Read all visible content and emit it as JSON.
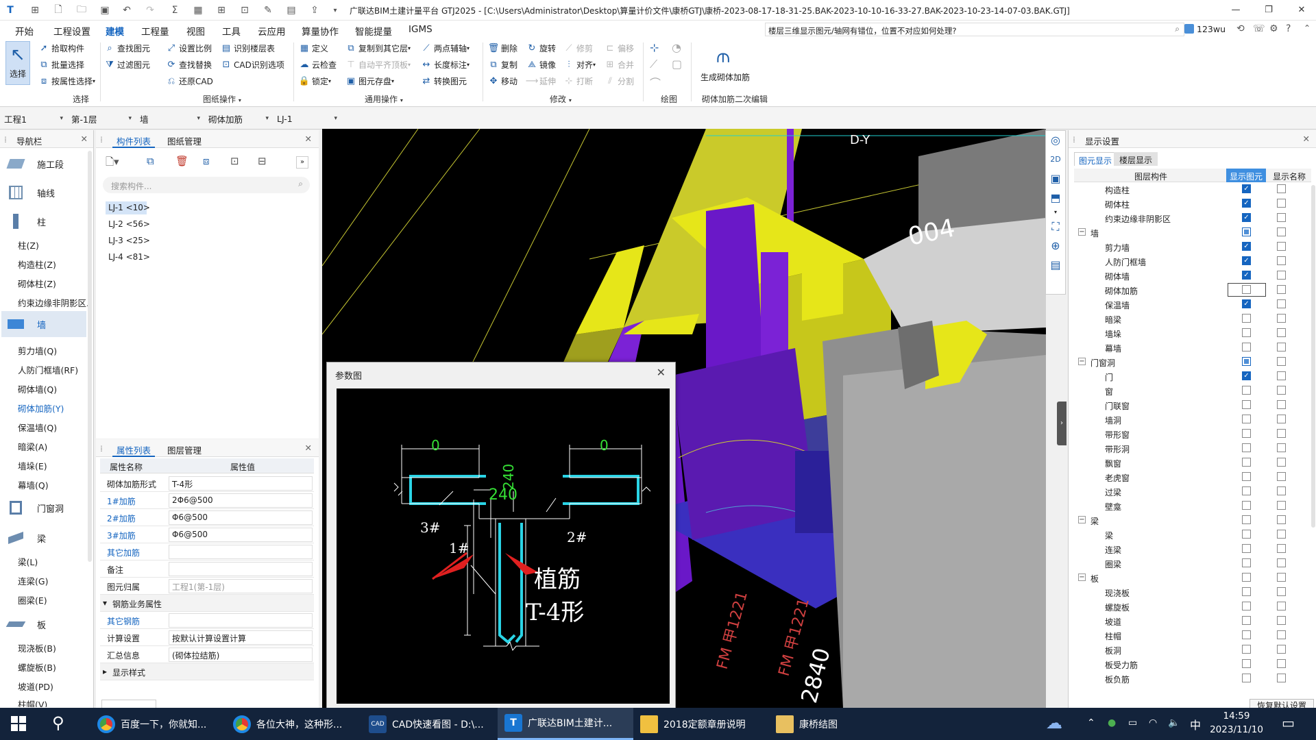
{
  "app": {
    "title": "广联达BIM土建计量平台 GTJ2025 - [C:\\Users\\Administrator\\Desktop\\算量计价文件\\康桥GTJ\\康桥-2023-08-17-18-31-25.BAK-2023-10-10-16-33-27.BAK-2023-10-23-14-07-03.BAK.GTJ]",
    "user": "123wu",
    "help_question": "楼层三维显示图元/轴网有错位，位置不对应如何处理?"
  },
  "menu": [
    "开始",
    "工程设置",
    "建模",
    "工程量",
    "视图",
    "工具",
    "云应用",
    "算量协作",
    "智能提量",
    "IGMS"
  ],
  "menu_active": "建模",
  "ribbon": {
    "select": "选择",
    "select_items": [
      "拾取构件",
      "批量选择",
      "按属性选择"
    ],
    "select_group": "选择",
    "drawing_items": [
      "查找图元",
      "过滤图元",
      "设置比例",
      "查找替换",
      "还原CAD",
      "识别楼层表",
      "CAD识别选项"
    ],
    "drawing_group": "图纸操作",
    "common_items": [
      "定义",
      "云检查",
      "锁定",
      "复制到其它层",
      "自动平齐顶板",
      "图元存盘",
      "两点辅轴",
      "长度标注",
      "转换图元"
    ],
    "common_group": "通用操作",
    "modify_items": [
      "删除",
      "旋转",
      "修剪",
      "偏移",
      "复制",
      "镜像",
      "对齐",
      "合并",
      "移动",
      "延伸",
      "打断",
      "分割"
    ],
    "modify_group": "修改",
    "draw_group": "绘图",
    "gen_label": "生成砌体加筋",
    "gen_group": "砌体加筋二次编辑"
  },
  "selectors": [
    "工程1",
    "第-1层",
    "墙",
    "砌体加筋",
    "LJ-1"
  ],
  "nav": {
    "title": "导航栏",
    "big": [
      {
        "label": "施工段",
        "icon": "construction-section-icon"
      },
      {
        "label": "轴线",
        "icon": "axis-icon"
      },
      {
        "label": "柱",
        "icon": "column-icon"
      },
      {
        "label": "墙",
        "icon": "wall-icon"
      },
      {
        "label": "门窗洞",
        "icon": "door-window-icon"
      },
      {
        "label": "梁",
        "icon": "beam-icon"
      },
      {
        "label": "板",
        "icon": "slab-icon"
      }
    ],
    "column_items": [
      "柱(Z)",
      "构造柱(Z)",
      "砌体柱(Z)",
      "约束边缘非阴影区."
    ],
    "wall_items": [
      "剪力墙(Q)",
      "人防门框墙(RF)",
      "砌体墙(Q)",
      "砌体加筋(Y)",
      "保温墙(Q)",
      "暗梁(A)",
      "墙垛(E)",
      "幕墙(Q)"
    ],
    "wall_active": "砌体加筋(Y)",
    "beam_items": [
      "梁(L)",
      "连梁(G)",
      "圈梁(E)"
    ],
    "slab_items": [
      "现浇板(B)",
      "螺旋板(B)",
      "坡道(PD)",
      "柱帽(V)"
    ]
  },
  "components": {
    "tabs": [
      "构件列表",
      "图纸管理"
    ],
    "search_placeholder": "搜索构件...",
    "items": [
      "LJ-1 <10>",
      "LJ-2 <56>",
      "LJ-3 <25>",
      "LJ-4 <81>"
    ],
    "selected": "LJ-1 <10>"
  },
  "props": {
    "tabs": [
      "属性列表",
      "图层管理"
    ],
    "col_name": "属性名称",
    "col_value": "属性值",
    "rows": [
      {
        "k": "砌体加筋形式",
        "v": "T-4形"
      },
      {
        "k": "1#加筋",
        "v": "2Φ6@500"
      },
      {
        "k": "2#加筋",
        "v": "Φ6@500"
      },
      {
        "k": "3#加筋",
        "v": "Φ6@500"
      },
      {
        "k": "其它加筋",
        "v": ""
      },
      {
        "k": "备注",
        "v": ""
      },
      {
        "k": "图元归属",
        "v": "工程1(第-1层)"
      },
      {
        "k": "钢筋业务属性",
        "v": ""
      },
      {
        "k": "其它钢筋",
        "v": ""
      },
      {
        "k": "计算设置",
        "v": "按默认计算设置计算"
      },
      {
        "k": "汇总信息",
        "v": "(砌体拉结筋)"
      },
      {
        "k": "显示样式",
        "v": ""
      }
    ]
  },
  "dialog": {
    "title": "参数图",
    "dim_left": "0",
    "dim_right": "0",
    "dim_240a": "240",
    "dim_240b": "240",
    "label_3": "3#",
    "label_2": "2#",
    "label_1": "1#",
    "label_plant": "植筋",
    "label_type": "T-4形"
  },
  "viewport": {
    "label_dy": "D-Y",
    "label_004": "004",
    "label_fm1": "FM 甲1221",
    "label_fm2": "FM 甲1221",
    "label_2840": "2840"
  },
  "display": {
    "title": "显示设置",
    "tabs": [
      "图元显示",
      "楼层显示"
    ],
    "col_layer": "图层构件",
    "col_show": "显示图元",
    "col_name": "显示名称",
    "restore": "恢复默认设置",
    "rows": [
      {
        "label": "构造柱",
        "level": 1,
        "show": "on",
        "name": false
      },
      {
        "label": "砌体柱",
        "level": 1,
        "show": "on",
        "name": false
      },
      {
        "label": "约束边缘非阴影区",
        "level": 1,
        "show": "on",
        "name": false
      },
      {
        "label": "墙",
        "level": 0,
        "show": "part",
        "name": false
      },
      {
        "label": "剪力墙",
        "level": 1,
        "show": "on",
        "name": false
      },
      {
        "label": "人防门框墙",
        "level": 1,
        "show": "on",
        "name": false
      },
      {
        "label": "砌体墙",
        "level": 1,
        "show": "on",
        "name": false
      },
      {
        "label": "砌体加筋",
        "level": 1,
        "show": "off",
        "name": false,
        "focus": true
      },
      {
        "label": "保温墙",
        "level": 1,
        "show": "on",
        "name": false
      },
      {
        "label": "暗梁",
        "level": 1,
        "show": "off",
        "name": false
      },
      {
        "label": "墙垛",
        "level": 1,
        "show": "off",
        "name": false
      },
      {
        "label": "幕墙",
        "level": 1,
        "show": "off",
        "name": false
      },
      {
        "label": "门窗洞",
        "level": 0,
        "show": "part",
        "name": false
      },
      {
        "label": "门",
        "level": 1,
        "show": "on",
        "name": false
      },
      {
        "label": "窗",
        "level": 1,
        "show": "off",
        "name": false
      },
      {
        "label": "门联窗",
        "level": 1,
        "show": "off",
        "name": false
      },
      {
        "label": "墙洞",
        "level": 1,
        "show": "off",
        "name": false
      },
      {
        "label": "带形窗",
        "level": 1,
        "show": "off",
        "name": false
      },
      {
        "label": "带形洞",
        "level": 1,
        "show": "off",
        "name": false
      },
      {
        "label": "飘窗",
        "level": 1,
        "show": "off",
        "name": false
      },
      {
        "label": "老虎窗",
        "level": 1,
        "show": "off",
        "name": false
      },
      {
        "label": "过梁",
        "level": 1,
        "show": "off",
        "name": false
      },
      {
        "label": "壁龛",
        "level": 1,
        "show": "off",
        "name": false
      },
      {
        "label": "梁",
        "level": 0,
        "show": "off",
        "name": false
      },
      {
        "label": "梁",
        "level": 1,
        "show": "off",
        "name": false
      },
      {
        "label": "连梁",
        "level": 1,
        "show": "off",
        "name": false
      },
      {
        "label": "圈梁",
        "level": 1,
        "show": "off",
        "name": false
      },
      {
        "label": "板",
        "level": 0,
        "show": "off",
        "name": false
      },
      {
        "label": "现浇板",
        "level": 1,
        "show": "off",
        "name": false
      },
      {
        "label": "螺旋板",
        "level": 1,
        "show": "off",
        "name": false
      },
      {
        "label": "坡道",
        "level": 1,
        "show": "off",
        "name": false
      },
      {
        "label": "柱帽",
        "level": 1,
        "show": "off",
        "name": false
      },
      {
        "label": "板洞",
        "level": 1,
        "show": "off",
        "name": false
      },
      {
        "label": "板受力筋",
        "level": 1,
        "show": "off",
        "name": false
      },
      {
        "label": "板负筋",
        "level": 1,
        "show": "off",
        "name": false
      }
    ]
  },
  "taskbar": {
    "items": [
      {
        "label": "百度一下，你就知...",
        "icon": "chrome-icon"
      },
      {
        "label": "各位大神，这种形...",
        "icon": "chrome-icon"
      },
      {
        "label": "CAD快速看图 - D:\\...",
        "icon": "cad-icon"
      },
      {
        "label": "广联达BIM土建计...",
        "icon": "gtj-icon"
      },
      {
        "label": "2018定额章册说明",
        "icon": "doc-icon"
      },
      {
        "label": "康桥结图",
        "icon": "folder-icon"
      }
    ],
    "ime": "中",
    "time": "14:59",
    "date": "2023/11/10"
  },
  "colors": {
    "accent": "#1565c0",
    "wall_yellow": "#e6e619",
    "wall_purple": "#7b22d6",
    "bar_cyan": "#2ad4e6",
    "dim_green": "#35e035"
  }
}
